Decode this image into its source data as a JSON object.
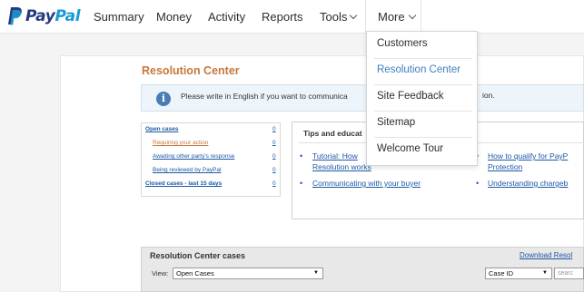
{
  "brand": {
    "pay": "Pay",
    "pal": "Pal",
    "colors": {
      "pay": "#253b80",
      "pal": "#179bd7"
    }
  },
  "nav": {
    "summary": "Summary",
    "money": "Money",
    "activity": "Activity",
    "reports": "Reports",
    "tools": "Tools",
    "more": "More"
  },
  "more_menu": {
    "items": [
      "Customers",
      "Resolution Center",
      "Site Feedback",
      "Sitemap",
      "Welcome Tour"
    ],
    "active_index": 1,
    "active_color": "#3e7fbf"
  },
  "page": {
    "title": "Resolution Center",
    "info_text": "Please write in English if you want to communica",
    "info_text_end": "ion."
  },
  "cases_list": {
    "open_cases": "Open cases",
    "requiring_action": "Requiring your action",
    "awaiting_other": "Awaiting other party's response",
    "being_reviewed": "Being reviewed by PayPal",
    "closed_cases": "Closed cases - last 15 days",
    "counts": [
      "0",
      "0",
      "0",
      "0",
      "0"
    ]
  },
  "tips": {
    "title": "Tips and educat",
    "links": {
      "tutorial_1": "Tutorial: How",
      "tutorial_2": "Resolution works",
      "communicating": "Communicating with your buyer",
      "qualify_1": "How to qualify for PayP",
      "qualify_2": "Protection",
      "understanding": "Understanding chargeb"
    }
  },
  "cases_section": {
    "title": "Resolution Center cases",
    "download": "Download Resol",
    "view_label": "View:",
    "view_value": "Open Cases",
    "filter_value": "Case ID",
    "search_placeholder": "searc"
  }
}
